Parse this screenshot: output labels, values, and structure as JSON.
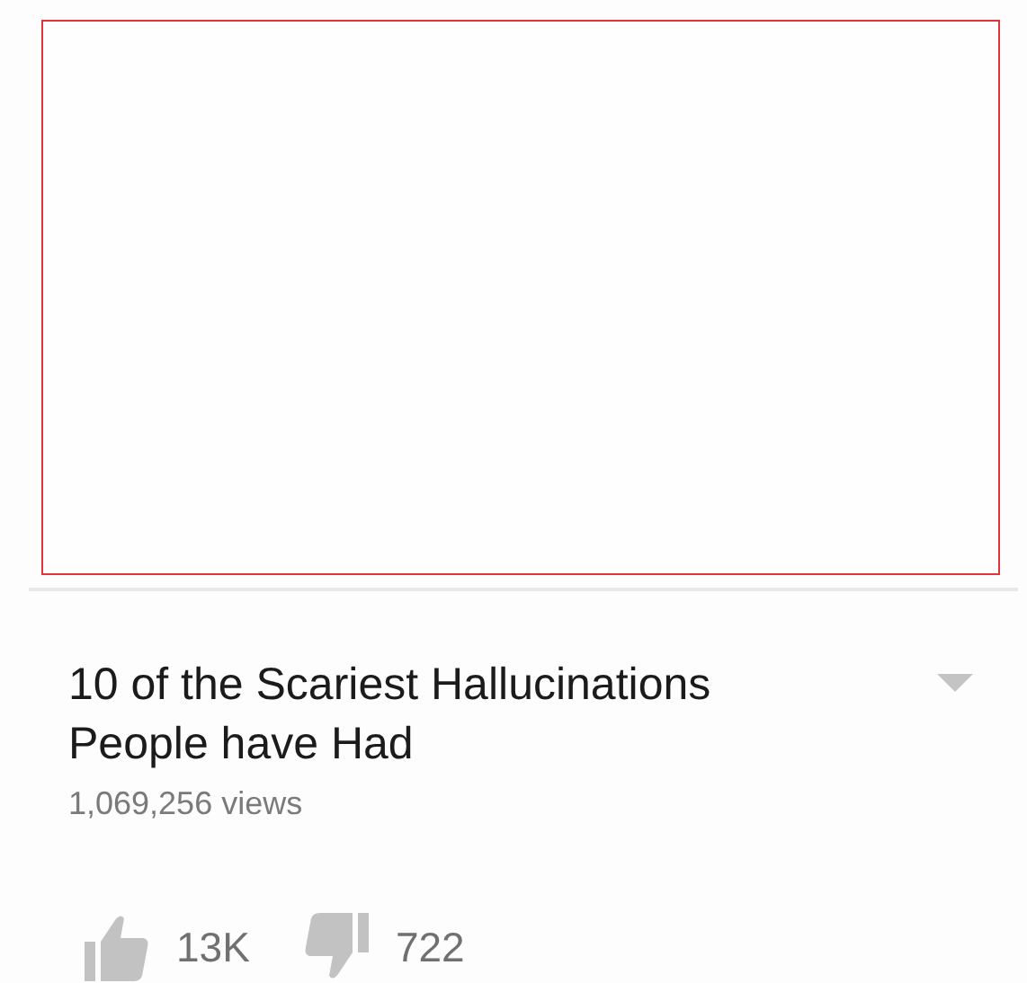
{
  "video": {
    "title": "10 of the Scariest Hallucinations People have Had",
    "views": "1,069,256 views",
    "likes": "13K",
    "dislikes": "722"
  }
}
